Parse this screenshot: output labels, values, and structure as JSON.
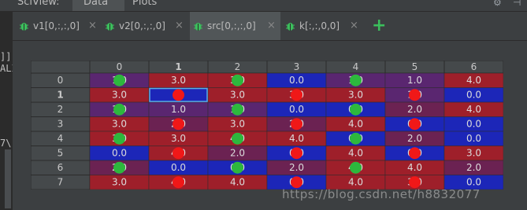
{
  "window": {
    "title_partial": "SciView:",
    "top_tabs": [
      "Data",
      "Plots"
    ],
    "gear_icon": "gear-icon",
    "hide_icon": "hide-icon"
  },
  "left_editor_fragments": [
    "]]",
    "ALI",
    "7\\"
  ],
  "tabs": [
    {
      "label": "v1[0,:,:,0]",
      "close": "×",
      "active": false
    },
    {
      "label": "v2[0,:,:,0]",
      "close": "×",
      "active": false
    },
    {
      "label": "src[0,:,:,0]",
      "close": "×",
      "active": true
    },
    {
      "label": "k[:,:,0,0]",
      "close": "×",
      "active": false
    }
  ],
  "add_tab_label": "+",
  "colors": {
    "blue": "#1c26b8",
    "red": "#9e1f2a",
    "purple": "#5a2670",
    "magenta": "#6b2252",
    "dot_green": "#2db83d",
    "dot_red": "#f01818",
    "selection": "#5eaee8"
  },
  "table": {
    "columns": [
      "0",
      "1",
      "2",
      "3",
      "4",
      "5",
      "6"
    ],
    "rows": [
      "0",
      "1",
      "2",
      "3",
      "4",
      "5",
      "6",
      "7"
    ],
    "bold_row": "1",
    "bold_column": "1",
    "selected_cell": [
      1,
      1
    ],
    "cells": [
      [
        {
          "v": "1.0",
          "c": "purple"
        },
        {
          "v": "3.0",
          "c": "red"
        },
        {
          "v": "3.0",
          "c": "red"
        },
        {
          "v": "0.0",
          "c": "blue"
        },
        {
          "v": "1.0",
          "c": "purple"
        },
        {
          "v": "1.0",
          "c": "purple"
        },
        {
          "v": "4.0",
          "c": "red"
        }
      ],
      [
        {
          "v": "3.0",
          "c": "red"
        },
        {
          "v": "",
          "c": "blue"
        },
        {
          "v": "3.0",
          "c": "red"
        },
        {
          "v": "3.0",
          "c": "red"
        },
        {
          "v": "3.0",
          "c": "red"
        },
        {
          "v": "1.0",
          "c": "purple"
        },
        {
          "v": "0.0",
          "c": "blue"
        }
      ],
      [
        {
          "v": "1.0",
          "c": "purple"
        },
        {
          "v": "1.0",
          "c": "purple"
        },
        {
          "v": "1.0",
          "c": "purple"
        },
        {
          "v": "0.0",
          "c": "blue"
        },
        {
          "v": "0.0",
          "c": "blue"
        },
        {
          "v": "2.0",
          "c": "magenta"
        },
        {
          "v": "4.0",
          "c": "red"
        }
      ],
      [
        {
          "v": "3.0",
          "c": "red"
        },
        {
          "v": "2.0",
          "c": "magenta"
        },
        {
          "v": "3.0",
          "c": "red"
        },
        {
          "v": "2.0",
          "c": "magenta"
        },
        {
          "v": "4.0",
          "c": "red"
        },
        {
          "v": "0.0",
          "c": "blue"
        },
        {
          "v": "0.0",
          "c": "blue"
        }
      ],
      [
        {
          "v": "3.0",
          "c": "red"
        },
        {
          "v": "3.0",
          "c": "red"
        },
        {
          "v": "4.0",
          "c": "red"
        },
        {
          "v": "4.0",
          "c": "red"
        },
        {
          "v": "0.0",
          "c": "blue"
        },
        {
          "v": "2.0",
          "c": "magenta"
        },
        {
          "v": "0.0",
          "c": "blue"
        }
      ],
      [
        {
          "v": "0.0",
          "c": "blue"
        },
        {
          "v": "4.0",
          "c": "red"
        },
        {
          "v": "2.0",
          "c": "magenta"
        },
        {
          "v": "0.0",
          "c": "blue"
        },
        {
          "v": "4.0",
          "c": "red"
        },
        {
          "v": "0.0",
          "c": "blue"
        },
        {
          "v": "3.0",
          "c": "red"
        }
      ],
      [
        {
          "v": "2.0",
          "c": "magenta"
        },
        {
          "v": "0.0",
          "c": "blue"
        },
        {
          "v": "0.0",
          "c": "blue"
        },
        {
          "v": "2.0",
          "c": "magenta"
        },
        {
          "v": "4.0",
          "c": "red"
        },
        {
          "v": "4.0",
          "c": "red"
        },
        {
          "v": "2.0",
          "c": "magenta"
        }
      ],
      [
        {
          "v": "3.0",
          "c": "red"
        },
        {
          "v": "4.0",
          "c": "red"
        },
        {
          "v": "4.0",
          "c": "red"
        },
        {
          "v": "0.0",
          "c": "blue"
        },
        {
          "v": "4.0",
          "c": "red"
        },
        {
          "v": "3.0",
          "c": "red"
        },
        {
          "v": "0.0",
          "c": "blue"
        }
      ]
    ],
    "markers": [
      {
        "row": 0,
        "col": 0,
        "color": "green"
      },
      {
        "row": 0,
        "col": 2,
        "color": "green"
      },
      {
        "row": 0,
        "col": 4,
        "color": "green"
      },
      {
        "row": 1,
        "col": 1,
        "color": "red"
      },
      {
        "row": 1,
        "col": 3,
        "color": "red"
      },
      {
        "row": 1,
        "col": 5,
        "color": "red"
      },
      {
        "row": 2,
        "col": 0,
        "color": "green"
      },
      {
        "row": 2,
        "col": 2,
        "color": "green"
      },
      {
        "row": 2,
        "col": 4,
        "color": "green"
      },
      {
        "row": 3,
        "col": 1,
        "color": "red"
      },
      {
        "row": 3,
        "col": 3,
        "color": "red"
      },
      {
        "row": 3,
        "col": 5,
        "color": "red"
      },
      {
        "row": 4,
        "col": 0,
        "color": "green"
      },
      {
        "row": 4,
        "col": 2,
        "color": "green"
      },
      {
        "row": 4,
        "col": 4,
        "color": "green"
      },
      {
        "row": 5,
        "col": 1,
        "color": "red"
      },
      {
        "row": 5,
        "col": 3,
        "color": "red"
      },
      {
        "row": 5,
        "col": 5,
        "color": "red"
      },
      {
        "row": 6,
        "col": 0,
        "color": "green"
      },
      {
        "row": 6,
        "col": 2,
        "color": "green"
      },
      {
        "row": 6,
        "col": 4,
        "color": "green"
      },
      {
        "row": 7,
        "col": 1,
        "color": "red"
      },
      {
        "row": 7,
        "col": 3,
        "color": "red"
      },
      {
        "row": 7,
        "col": 5,
        "color": "red"
      }
    ]
  },
  "watermark": "https://blog.csdn.net/h8832077"
}
